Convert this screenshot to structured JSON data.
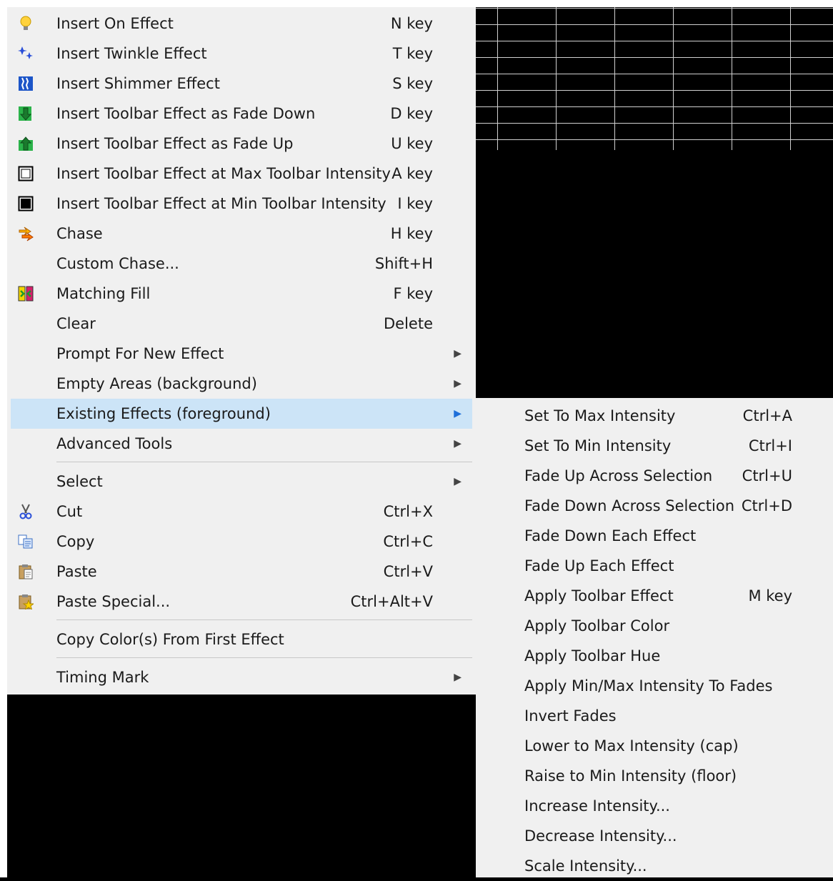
{
  "main_menu": {
    "items": [
      {
        "label": "Insert On Effect",
        "shortcut": "N key",
        "icon": "lightbulb-icon"
      },
      {
        "label": "Insert Twinkle Effect",
        "shortcut": "T key",
        "icon": "twinkle-icon"
      },
      {
        "label": "Insert Shimmer Effect",
        "shortcut": "S key",
        "icon": "shimmer-icon"
      },
      {
        "label": "Insert Toolbar Effect as Fade Down",
        "shortcut": "D key",
        "icon": "fade-down-icon"
      },
      {
        "label": "Insert Toolbar Effect as Fade Up",
        "shortcut": "U key",
        "icon": "fade-up-icon"
      },
      {
        "label": "Insert Toolbar Effect at Max Toolbar Intensity",
        "shortcut": "A key",
        "icon": "max-intensity-icon"
      },
      {
        "label": "Insert Toolbar Effect at Min Toolbar Intensity",
        "shortcut": "I key",
        "icon": "min-intensity-icon"
      },
      {
        "label": "Chase",
        "shortcut": "H key",
        "icon": "chase-icon"
      },
      {
        "label": "Custom Chase...",
        "shortcut": "Shift+H"
      },
      {
        "label": "Matching Fill",
        "shortcut": "F key",
        "icon": "matching-fill-icon"
      },
      {
        "label": "Clear",
        "shortcut": "Delete"
      },
      {
        "label": "Prompt For New Effect",
        "submenu": true
      },
      {
        "label": "Empty Areas (background)",
        "submenu": true
      },
      {
        "label": "Existing Effects (foreground)",
        "submenu": true,
        "highlighted": true
      },
      {
        "label": "Advanced Tools",
        "submenu": true
      },
      {
        "label": "Select",
        "submenu": true
      },
      {
        "label": "Cut",
        "shortcut": "Ctrl+X",
        "icon": "scissors-icon"
      },
      {
        "label": "Copy",
        "shortcut": "Ctrl+C",
        "icon": "copy-icon"
      },
      {
        "label": "Paste",
        "shortcut": "Ctrl+V",
        "icon": "paste-icon"
      },
      {
        "label": "Paste Special...",
        "shortcut": "Ctrl+Alt+V",
        "icon": "paste-special-icon"
      },
      {
        "label": "Copy Color(s) From First Effect"
      },
      {
        "label": "Timing Mark",
        "submenu": true
      }
    ],
    "submenu_arrow": "▶"
  },
  "sub_menu": {
    "items": [
      {
        "label": "Set To Max Intensity",
        "shortcut": "Ctrl+A"
      },
      {
        "label": "Set To Min Intensity",
        "shortcut": "Ctrl+I"
      },
      {
        "label": "Fade Up Across Selection",
        "shortcut": "Ctrl+U"
      },
      {
        "label": "Fade Down Across Selection",
        "shortcut": "Ctrl+D"
      },
      {
        "label": "Fade Down Each Effect"
      },
      {
        "label": "Fade Up Each Effect"
      },
      {
        "label": "Apply Toolbar Effect",
        "shortcut": "M key"
      },
      {
        "label": "Apply Toolbar Color"
      },
      {
        "label": "Apply Toolbar Hue"
      },
      {
        "label": "Apply Min/Max Intensity To Fades"
      },
      {
        "label": "Invert Fades"
      },
      {
        "label": "Lower to Max Intensity (cap)"
      },
      {
        "label": "Raise to Min Intensity (floor)"
      },
      {
        "label": "Increase Intensity..."
      },
      {
        "label": "Decrease Intensity..."
      },
      {
        "label": "Scale Intensity..."
      }
    ]
  },
  "colors": {
    "menu_bg": "#f0f0f0",
    "highlight": "#cce4f7",
    "arrow_active": "#1e6fd9"
  }
}
